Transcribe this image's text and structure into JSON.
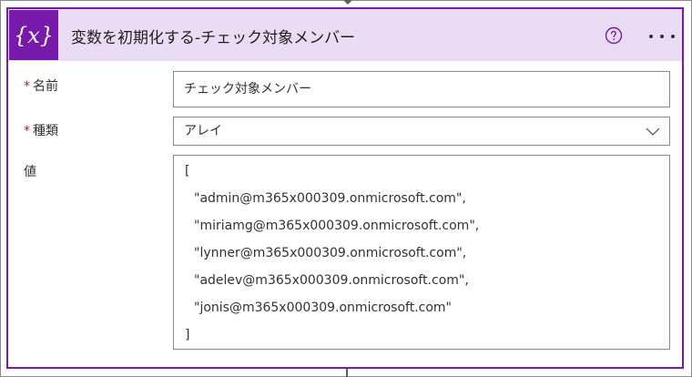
{
  "header": {
    "icon_glyph": "{x}",
    "title": "変数を初期化する-チェック対象メンバー",
    "help_icon": "help-circle-icon",
    "more_icon": "more-options-icon",
    "accent_color": "#7719aa",
    "header_bg": "#eadcf4"
  },
  "fields": {
    "name": {
      "required_mark": "*",
      "label": "名前",
      "value": "チェック対象メンバー"
    },
    "type": {
      "required_mark": "*",
      "label": "種類",
      "value": "アレイ"
    },
    "value": {
      "label": "値",
      "lines": [
        "[",
        "\"admin@m365x000309.onmicrosoft.com\",",
        "\"miriamg@m365x000309.onmicrosoft.com\",",
        "\"lynner@m365x000309.onmicrosoft.com\",",
        "\"adelev@m365x000309.onmicrosoft.com\",",
        "\"jonis@m365x000309.onmicrosoft.com\"",
        "]"
      ]
    }
  }
}
